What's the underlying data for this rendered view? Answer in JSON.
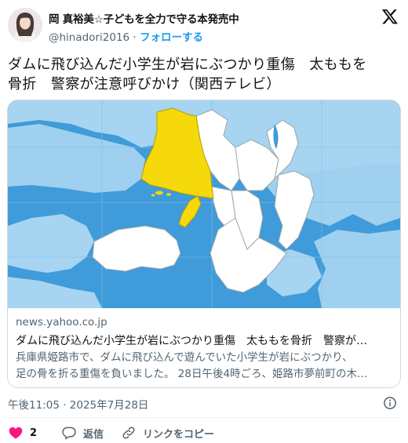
{
  "author": {
    "name": "岡 真裕美☆子どもを全力で守る本発売中",
    "handle": "@hinadori2016",
    "separator": "·",
    "follow_label": "フォローする"
  },
  "tweet": {
    "line1": "ダムに飛び込んだ小学生が岩にぶつかり重傷　太ももを",
    "line2": "骨折　警察が注意呼びかけ（関西テレビ）"
  },
  "card": {
    "domain": "news.yahoo.co.jp",
    "title": "ダムに飛び込んだ小学生が岩にぶつかり重傷　太ももを骨折　警察が…",
    "desc_line1": "兵庫県姫路市で、ダムに飛び込んで遊んでいた小学生が岩にぶつかり、",
    "desc_line2": "足の骨を折る重傷を負いました。 28日午後4時ごろ、姫路市夢前町の木…"
  },
  "meta": {
    "timestamp": "午後11:05 · 2025年7月28日"
  },
  "actions": {
    "like_count": "2",
    "reply_label": "返信",
    "copy_link_label": "リンクをコピー"
  },
  "icons": {
    "like": "heart-icon",
    "reply": "reply-bubble-icon",
    "copy": "link-icon",
    "info": "info-icon",
    "brand": "x-logo-icon"
  },
  "colors": {
    "accent": "#1d9bf0",
    "like": "#f91880",
    "sea": "#3f9bd9",
    "highlight": "#f5d90a"
  }
}
